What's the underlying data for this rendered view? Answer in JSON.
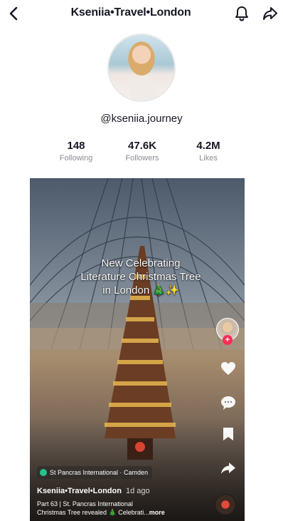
{
  "header": {
    "title": "Kseniia•Travel•London",
    "back_icon": "chevron-left-icon",
    "bell_icon": "bell-icon",
    "share_icon": "share-arrow-icon"
  },
  "profile": {
    "handle": "@kseniia.journey",
    "stats": [
      {
        "value": "148",
        "label": "Following"
      },
      {
        "value": "47.6K",
        "label": "Followers"
      },
      {
        "value": "4.2M",
        "label": "Likes"
      }
    ]
  },
  "video": {
    "overlay_line1": "New Celebrating",
    "overlay_line2": "Literature Christmas Tree",
    "overlay_line3": "in London 🎄✨",
    "location": "St Pancras International · Camden",
    "author": "Kseniia•Travel•London",
    "ago": "1d ago",
    "caption_line1": "Part 63 | St. Pancras International",
    "caption_line2": "Christmas Tree revealed 🎄 Celebrati...",
    "more_label": "more"
  },
  "colors": {
    "accent": "#fe2c55",
    "muted_text": "#8a8b91",
    "location_dot": "#25c28a"
  }
}
